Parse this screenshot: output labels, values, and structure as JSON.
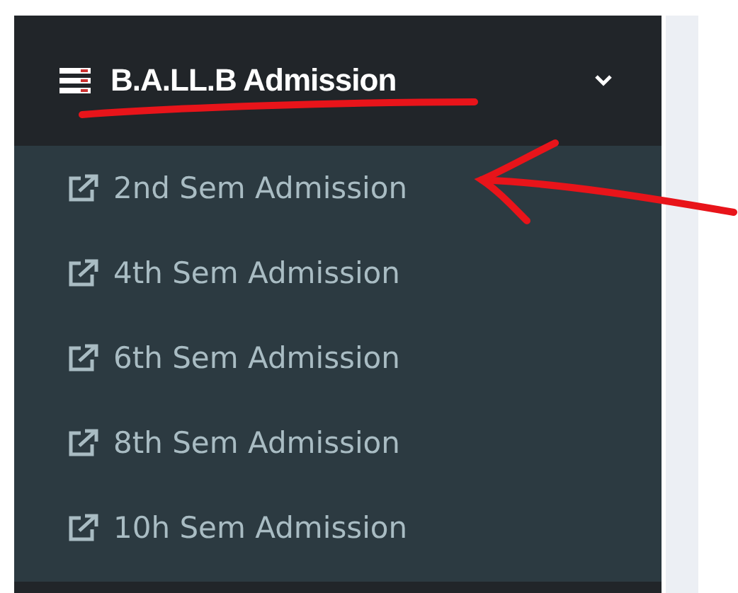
{
  "sidebar": {
    "menu": {
      "label": "B.A.LL.B Admission",
      "expanded": true,
      "items": [
        {
          "label": "2nd Sem Admission"
        },
        {
          "label": "4th Sem Admission"
        },
        {
          "label": "6th Sem Admission"
        },
        {
          "label": "8th Sem Admission"
        },
        {
          "label": "10h Sem Admission"
        }
      ]
    }
  }
}
